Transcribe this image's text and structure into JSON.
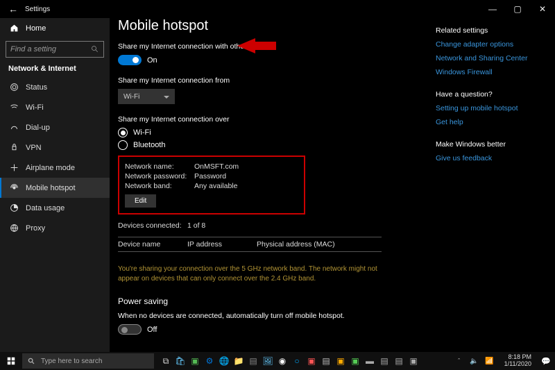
{
  "window": {
    "title": "Settings"
  },
  "sidebar": {
    "home": "Home",
    "search_placeholder": "Find a setting",
    "section": "Network & Internet",
    "items": [
      {
        "label": "Status"
      },
      {
        "label": "Wi-Fi"
      },
      {
        "label": "Dial-up"
      },
      {
        "label": "VPN"
      },
      {
        "label": "Airplane mode"
      },
      {
        "label": "Mobile hotspot"
      },
      {
        "label": "Data usage"
      },
      {
        "label": "Proxy"
      }
    ]
  },
  "main": {
    "title": "Mobile hotspot",
    "share_label": "Share my Internet connection with other devices",
    "toggle_state": "On",
    "share_from_label": "Share my Internet connection from",
    "share_from_value": "Wi-Fi",
    "share_over_label": "Share my Internet connection over",
    "radio_wifi": "Wi-Fi",
    "radio_bluetooth": "Bluetooth",
    "network_name_label": "Network name:",
    "network_name_value": "OnMSFT.com",
    "network_password_label": "Network password:",
    "network_password_value": "Password",
    "network_band_label": "Network band:",
    "network_band_value": "Any available",
    "edit_label": "Edit",
    "devices_connected_label": "Devices connected:",
    "devices_connected_value": "1 of 8",
    "col_device": "Device name",
    "col_ip": "IP address",
    "col_mac": "Physical address (MAC)",
    "warning": "You're sharing your connection over the 5 GHz network band. The network might not appear on devices that can only connect over the 2.4 GHz band.",
    "power_saving": "Power saving",
    "power_saving_sub": "When no devices are connected, automatically turn off mobile hotspot.",
    "power_toggle": "Off"
  },
  "right": {
    "related": "Related settings",
    "link1": "Change adapter options",
    "link2": "Network and Sharing Center",
    "link3": "Windows Firewall",
    "question": "Have a question?",
    "link4": "Setting up mobile hotspot",
    "link5": "Get help",
    "better": "Make Windows better",
    "link6": "Give us feedback"
  },
  "taskbar": {
    "search": "Type here to search",
    "time": "8:18 PM",
    "date": "1/11/2020"
  }
}
